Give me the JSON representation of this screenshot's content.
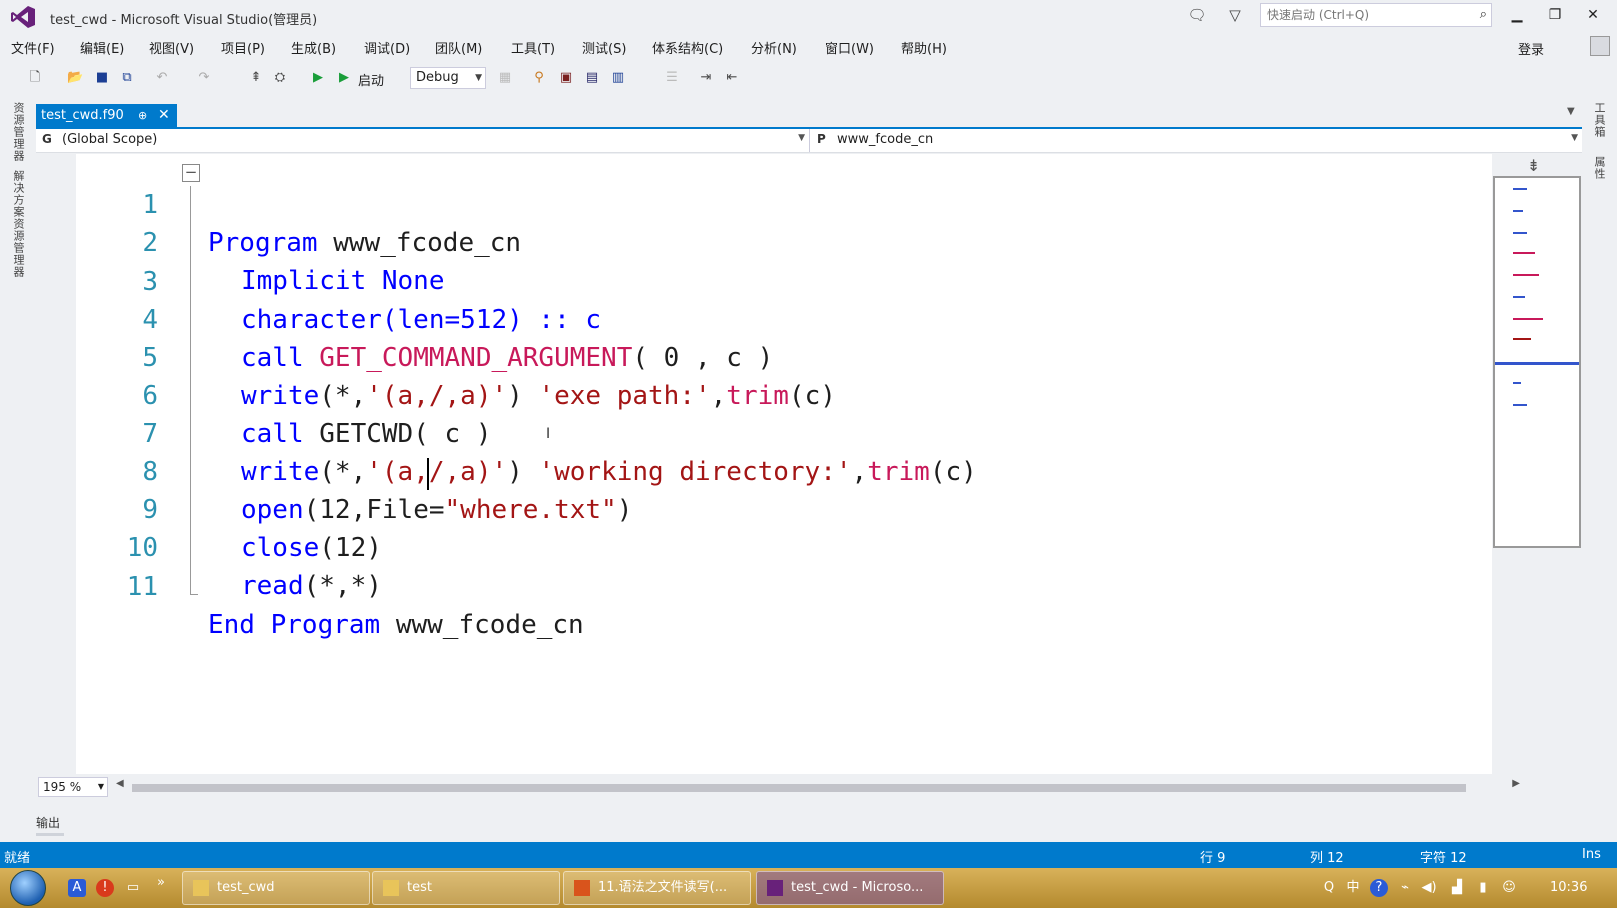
{
  "window": {
    "title": "test_cwd - Microsoft Visual Studio(管理员)",
    "quick_launch_placeholder": "快速启动 (Ctrl+Q)",
    "login": "登录"
  },
  "menu": [
    "文件(F)",
    "编辑(E)",
    "视图(V)",
    "项目(P)",
    "生成(B)",
    "调试(D)",
    "团队(M)",
    "工具(T)",
    "测试(S)",
    "体系结构(C)",
    "分析(N)",
    "窗口(W)",
    "帮助(H)"
  ],
  "toolbar": {
    "start_label": "启动",
    "config": "Debug"
  },
  "left_tabs": [
    "资源管理器",
    "解决方案资源管理器"
  ],
  "right_tabs": [
    "工具箱",
    "属性"
  ],
  "doc_tab": {
    "name": "test_cwd.f90",
    "pin": "⊕",
    "close": "✕"
  },
  "nav": {
    "left_badge": "G",
    "left_text": "(Global Scope)",
    "right_badge": "P",
    "right_text": "www_fcode_cn"
  },
  "code_lines": [
    {
      "n": "1"
    },
    {
      "n": "2"
    },
    {
      "n": "3"
    },
    {
      "n": "4"
    },
    {
      "n": "5"
    },
    {
      "n": "6"
    },
    {
      "n": "7"
    },
    {
      "n": "8"
    },
    {
      "n": "9"
    },
    {
      "n": "10"
    },
    {
      "n": "11"
    }
  ],
  "code": {
    "l1": [
      "Program",
      " www_fcode_cn"
    ],
    "l2": [
      "Implicit None"
    ],
    "l3": [
      "character(len=512) :: c"
    ],
    "l4": [
      "call ",
      "GET_COMMAND_ARGUMENT",
      "( 0 , c )"
    ],
    "l5": [
      "write",
      "(*,",
      "'(a,/,a)'",
      ") ",
      "'exe path:'",
      ",",
      "trim",
      "(c)"
    ],
    "l6": [
      "call ",
      "GETCWD( c )"
    ],
    "l7": [
      "write",
      "(*,",
      "'(a,/,a)'",
      ") ",
      "'working directory:'",
      ",",
      "trim",
      "(c)"
    ],
    "l8": [
      "open",
      "(12,File=",
      "\"where.txt\"",
      ")"
    ],
    "l9": [
      "close",
      "(12)"
    ],
    "l10": [
      "read",
      "(*,*)"
    ],
    "l11": [
      "End Program",
      " www_fcode_cn"
    ]
  },
  "editor": {
    "zoom": "195 %"
  },
  "output_tab": "输出",
  "status": {
    "ready": "就绪",
    "row": "行 9",
    "col": "列 12",
    "char": "字符 12",
    "mode": "Ins"
  },
  "taskbar": {
    "tasks": [
      "test_cwd",
      "test",
      "11.语法之文件读写(...",
      "test_cwd - Microso..."
    ],
    "clock": "10:36"
  },
  "colors": {
    "accent": "#007acc",
    "keyword": "#0000ff",
    "function": "#c8195a",
    "string": "#a31515",
    "line_number": "#2b91af"
  }
}
